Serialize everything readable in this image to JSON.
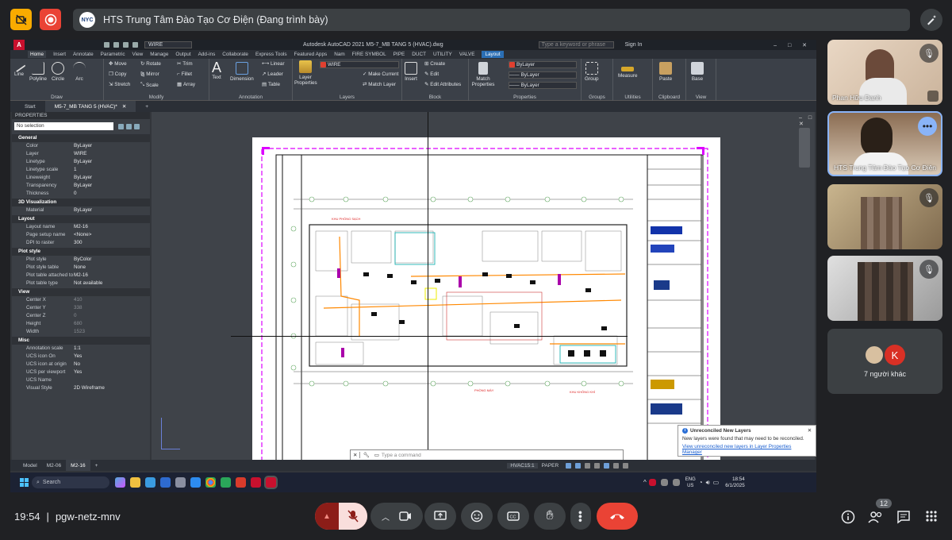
{
  "meet": {
    "presenter_logo": "NYC",
    "presenting_label": "HTS Trung Tâm Đào Tạo Cơ Điện (Đang trình bày)",
    "time": "19:54",
    "separator": "|",
    "meeting_code": "pgw-netz-mnv",
    "participant_count": "12",
    "others_label": "7 người khác",
    "others_initial": "K",
    "colors": {
      "red_button": "#ea4335",
      "yellow_button": "#f9ab00",
      "bg": "#202124"
    }
  },
  "tiles": [
    {
      "name": "Phan Hữu Danh"
    },
    {
      "name": "HTS Trung Tâm Đào Tạo Cơ Điện"
    },
    {
      "name": ""
    },
    {
      "name": ""
    }
  ],
  "autocad": {
    "title": "Autodesk AutoCAD 2021   M5-7_MB TANG 5 (HVAC).dwg",
    "layer_dropdown": "WIRE",
    "search_placeholder": "Type a keyword or phrase",
    "sign_in": "Sign In",
    "tabs": [
      "Home",
      "Insert",
      "Annotate",
      "Parametric",
      "View",
      "Manage",
      "Output",
      "Add-ins",
      "Collaborate",
      "Express Tools",
      "Featured Apps",
      "Nam",
      "FIRE SYMBOL",
      "PIPE",
      "DUCT",
      "UTILITY",
      "VALVE",
      "Layout"
    ],
    "ribbon": {
      "draw": {
        "label": "Draw",
        "tools": [
          "Line",
          "Polyline",
          "Circle",
          "Arc"
        ]
      },
      "modify": {
        "label": "Modify",
        "rows": [
          "Move",
          "Rotate",
          "Trim",
          "Copy",
          "Mirror",
          "Fillet",
          "Stretch",
          "Scale",
          "Array"
        ]
      },
      "annotation": {
        "label": "Annotation",
        "tools": [
          "Text",
          "Dimension"
        ],
        "rows": [
          "Linear",
          "Leader",
          "Table"
        ]
      },
      "layers": {
        "label": "Layers",
        "big": "Layer Properties",
        "current": "WIRE",
        "rows": [
          "Make Current",
          "Match Layer"
        ]
      },
      "block": {
        "label": "Block",
        "big": "Insert",
        "rows": [
          "Create",
          "Edit",
          "Edit Attributes"
        ]
      },
      "properties": {
        "label": "Properties",
        "big": "Match Properties",
        "rows": [
          "ByLayer",
          "ByLayer",
          "ByLayer"
        ]
      },
      "groups": {
        "label": "Groups",
        "big": "Group"
      },
      "utilities": {
        "label": "Utilities",
        "big": "Measure"
      },
      "clipboard": {
        "label": "Clipboard",
        "big": "Paste"
      },
      "view": {
        "label": "View",
        "big": "Base"
      }
    },
    "doc_tabs": [
      "Start",
      "M5-7_MB TANG 5 (HVAC)*"
    ],
    "properties": {
      "header": "PROPERTIES",
      "selection": "No selection",
      "sections": [
        {
          "title": "General",
          "rows": [
            [
              "Color",
              "ByLayer"
            ],
            [
              "Layer",
              "WIRE"
            ],
            [
              "Linetype",
              "ByLayer"
            ],
            [
              "Linetype scale",
              "1"
            ],
            [
              "Lineweight",
              "ByLayer"
            ],
            [
              "Transparency",
              "ByLayer"
            ],
            [
              "Thickness",
              "0"
            ]
          ]
        },
        {
          "title": "3D Visualization",
          "rows": [
            [
              "Material",
              "ByLayer"
            ]
          ]
        },
        {
          "title": "Layout",
          "rows": [
            [
              "Layout name",
              "M2-16"
            ],
            [
              "Page setup name",
              "<None>"
            ],
            [
              "DPI to raster",
              "300"
            ]
          ]
        },
        {
          "title": "Plot style",
          "rows": [
            [
              "Plot style",
              "ByColor"
            ],
            [
              "Plot style table",
              "None"
            ],
            [
              "Plot table attached to",
              "M2-16"
            ],
            [
              "Plot table type",
              "Not available"
            ]
          ]
        },
        {
          "title": "View",
          "rows": [
            [
              "Center X",
              "410"
            ],
            [
              "Center Y",
              "338"
            ],
            [
              "Center Z",
              "0"
            ],
            [
              "Height",
              "680"
            ],
            [
              "Width",
              "1523"
            ]
          ]
        },
        {
          "title": "Misc",
          "rows": [
            [
              "Annotation scale",
              "1:1"
            ],
            [
              "UCS icon On",
              "Yes"
            ],
            [
              "UCS icon at origin",
              "No"
            ],
            [
              "UCS per viewport",
              "Yes"
            ],
            [
              "UCS Name",
              ""
            ],
            [
              "Visual Style",
              "2D Wireframe"
            ]
          ]
        }
      ]
    },
    "command_placeholder": "Type a command",
    "notification": {
      "title": "Unreconciled New Layers",
      "body": "New layers were found that may need to be reconciled.",
      "link": "View unreconciled new layers in Layer Properties Manager"
    },
    "layout_tabs": [
      "Model",
      "M2-06",
      "M2-16"
    ],
    "status": {
      "scale": "HVAC15:1",
      "space": "PAPER"
    },
    "taskbar": {
      "search": "Search",
      "lang": "ENG",
      "region": "US",
      "clock_time": "18:54",
      "clock_date": "6/1/2025"
    }
  }
}
